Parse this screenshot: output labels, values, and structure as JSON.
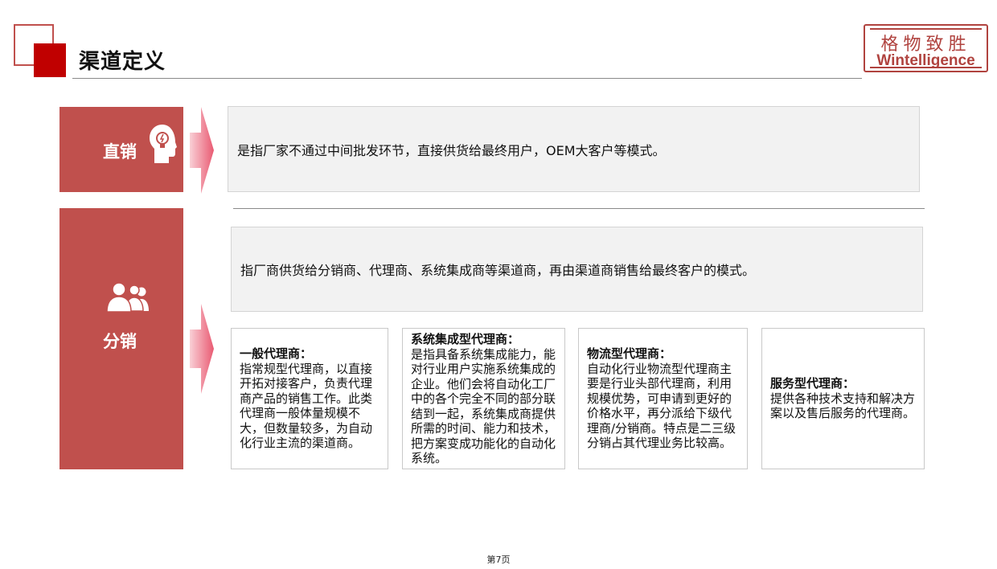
{
  "header": {
    "title": "渠道定义",
    "logo": {
      "cn": "格物致胜",
      "en": "Wintelligence"
    }
  },
  "direct": {
    "label": "直销",
    "icon": "lightbulb-head-icon",
    "description": "是指厂家不通过中间批发环节，直接供货给最终用户，OEM大客户等模式。"
  },
  "distribution": {
    "label": "分销",
    "icon": "people-group-icon",
    "description": "指厂商供货给分销商、代理商、系统集成商等渠道商，再由渠道商销售给最终客户的模式。",
    "types": [
      {
        "title": "一般代理商：",
        "body": "指常规型代理商，以直接开拓对接客户，负责代理商产品的销售工作。此类代理商一般体量规模不大，但数量较多，为自动化行业主流的渠道商。"
      },
      {
        "title": "系统集成型代理商：",
        "body": "是指具备系统集成能力，能对行业用户实施系统集成的企业。他们会将自动化工厂中的各个完全不同的部分联结到一起，系统集成商提供所需的时间、能力和技术，把方案变成功能化的自动化系统。"
      },
      {
        "title": "物流型代理商：",
        "body": "自动化行业物流型代理商主要是行业头部代理商，利用规模优势，可申请到更好的价格水平，再分派给下级代理商/分销商。特点是二三级分销占其代理业务比较高。"
      },
      {
        "title": "服务型代理商：",
        "body": "提供各种技术支持和解决方案以及售后服务的代理商。"
      }
    ]
  },
  "colors": {
    "accent": "#c0504d",
    "dark_red": "#c00000",
    "panel_bg": "#f2f2f2"
  },
  "footer": {
    "page": "第7页"
  }
}
